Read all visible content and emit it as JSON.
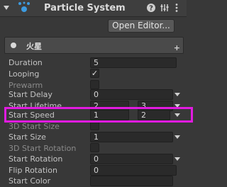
{
  "header": {
    "title": "Particle System",
    "collapse_icon": "chevron-down-icon",
    "component_icon": "particle-system-icon",
    "icons": [
      "help-icon",
      "preset-icon",
      "more-icon"
    ]
  },
  "open_editor_label": "Open Editor...",
  "module": {
    "title": "火星",
    "add_label": "+"
  },
  "rows": {
    "duration": {
      "label": "Duration",
      "value": "5"
    },
    "looping": {
      "label": "Looping",
      "checked": true,
      "check_glyph": "✓"
    },
    "prewarm": {
      "label": "Prewarm",
      "checked": false
    },
    "start_delay": {
      "label": "Start Delay",
      "value": "0"
    },
    "start_lifetime": {
      "label": "Start Lifetime",
      "min": "2",
      "max": "3"
    },
    "start_speed": {
      "label": "Start Speed",
      "min": "1",
      "max": "2"
    },
    "start_size_3d": {
      "label": "3D Start Size",
      "checked": false
    },
    "start_size": {
      "label": "Start Size",
      "value": "1"
    },
    "start_rotation_3d": {
      "label": "3D Start Rotation",
      "checked": false
    },
    "start_rotation": {
      "label": "Start Rotation",
      "value": "0"
    },
    "flip_rotation": {
      "label": "Flip Rotation",
      "value": "0"
    },
    "start_color": {
      "label": "Start Color"
    }
  },
  "colors": {
    "highlight": "#e11be0",
    "accent_icon": "#3d9be0"
  }
}
